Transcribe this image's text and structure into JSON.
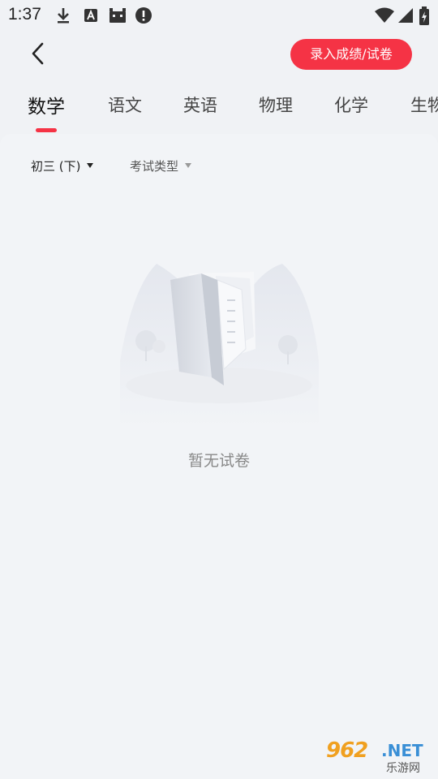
{
  "status_bar": {
    "time": "1:37",
    "icons": [
      "download-icon",
      "text-a-icon",
      "android-icon",
      "alert-icon",
      "wifi-icon",
      "signal-icon",
      "battery-icon"
    ]
  },
  "header": {
    "back_icon": "chevron-left-icon",
    "action_label": "录入成绩/试卷",
    "accent_color": "#f53345"
  },
  "tabs": [
    {
      "label": "数学",
      "active": true
    },
    {
      "label": "语文",
      "active": false
    },
    {
      "label": "英语",
      "active": false
    },
    {
      "label": "物理",
      "active": false
    },
    {
      "label": "化学",
      "active": false
    },
    {
      "label": "生物",
      "active": false
    }
  ],
  "filters": {
    "grade": "初三 (下)",
    "exam_type": "考试类型"
  },
  "empty_state": {
    "icon": "book-illustration-icon",
    "message": "暂无试卷"
  },
  "watermark": {
    "number": "962",
    "domain": ".NET",
    "site": "乐游网"
  }
}
